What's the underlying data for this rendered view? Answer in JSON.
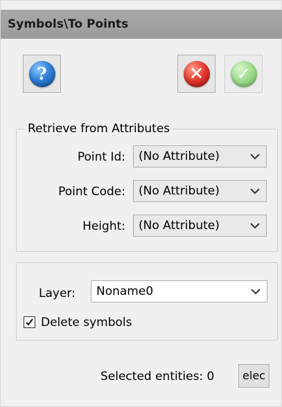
{
  "window": {
    "title": "Symbols\\To Points"
  },
  "toolbar": {
    "help_icon": "help-icon",
    "cancel_icon": "cancel-icon",
    "ok_icon": "ok-icon"
  },
  "retrieve_group": {
    "title": "Retrieve from Attributes",
    "rows": [
      {
        "label": "Point Id:",
        "value": "(No Attribute)"
      },
      {
        "label": "Point Code:",
        "value": "(No Attribute)"
      },
      {
        "label": "Height:",
        "value": "(No Attribute)"
      }
    ]
  },
  "layer_group": {
    "layer_label": "Layer:",
    "layer_value": "Noname0",
    "delete_symbols_label": "Delete symbols",
    "delete_symbols_checked": true
  },
  "footer": {
    "selected_label": "Selected entities: 0",
    "select_button_label": "elec"
  },
  "colors": {
    "titlebar": "#a3a3a3",
    "panel": "#f0f0f0",
    "help": "#2f7fd8",
    "cancel": "#e2352a",
    "ok": "#8ed97a"
  }
}
